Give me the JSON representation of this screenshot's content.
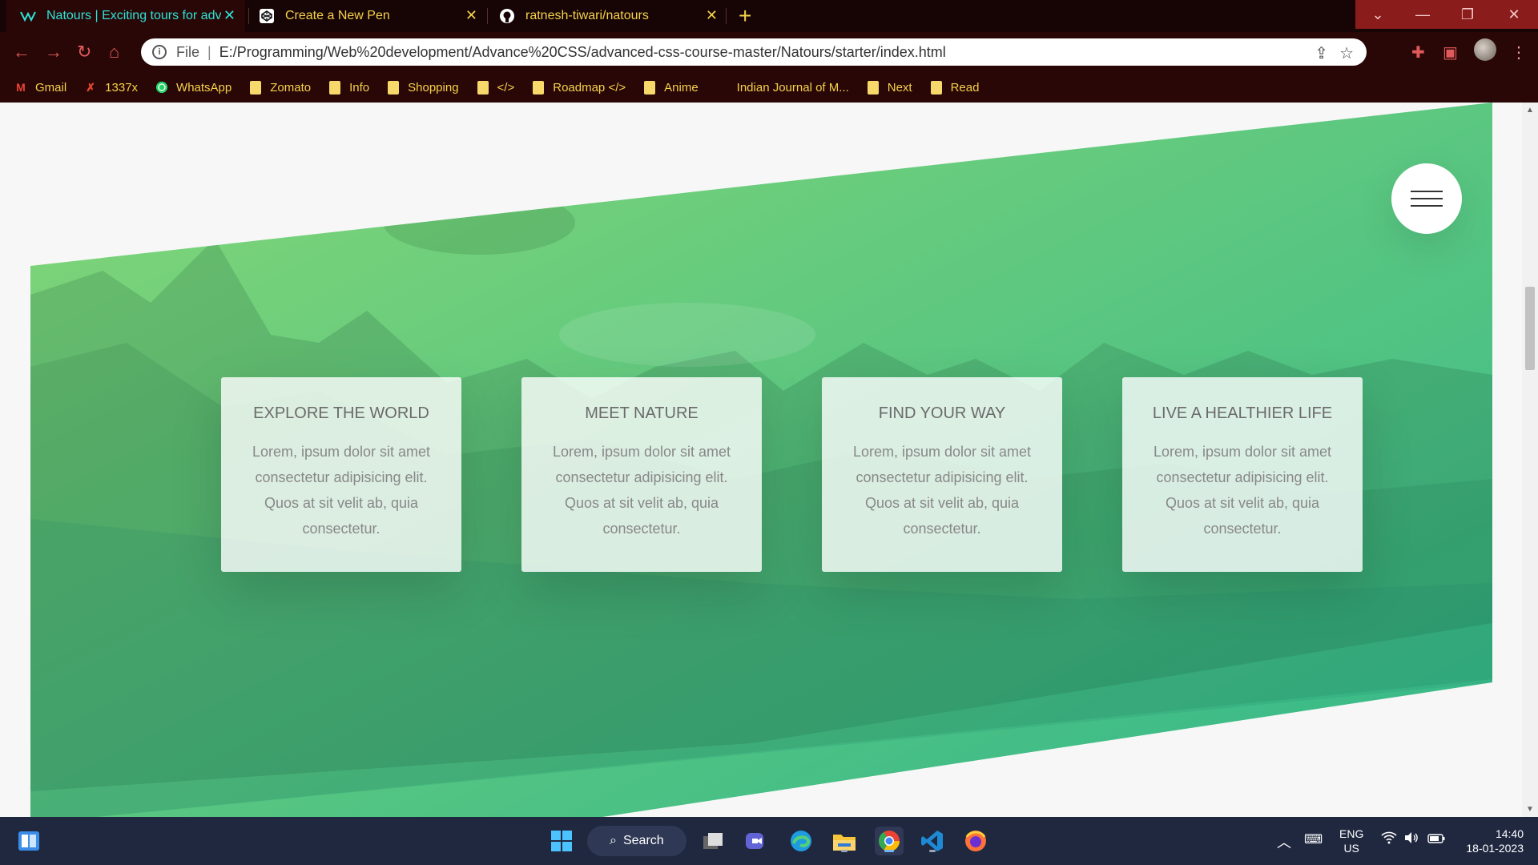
{
  "browser": {
    "tabs": [
      {
        "title": "Natours | Exciting tours for adventurous people",
        "icon": "natours-logo-icon",
        "active": true
      },
      {
        "title": "Create a New Pen",
        "icon": "codepen-icon",
        "active": false
      },
      {
        "title": "ratnesh-tiwari/natours",
        "icon": "github-icon",
        "active": false
      }
    ],
    "address": {
      "scheme_label": "File",
      "url": "E:/Programming/Web%20development/Advance%20CSS/advanced-css-course-master/Natours/starter/index.html"
    },
    "bookmarks": [
      {
        "label": "Gmail",
        "icon": "gmail-icon"
      },
      {
        "label": "1337x",
        "icon": "x-icon"
      },
      {
        "label": "WhatsApp",
        "icon": "whatsapp-icon"
      },
      {
        "label": "Zomato",
        "icon": "folder-icon"
      },
      {
        "label": "Info",
        "icon": "folder-icon"
      },
      {
        "label": "Shopping",
        "icon": "folder-icon"
      },
      {
        "label": "</>",
        "icon": "folder-icon"
      },
      {
        "label": "Roadmap </>",
        "icon": "folder-icon"
      },
      {
        "label": "Anime",
        "icon": "folder-icon"
      },
      {
        "label": "Indian Journal of M...",
        "icon": "none"
      },
      {
        "label": "Next",
        "icon": "folder-icon"
      },
      {
        "label": "Read",
        "icon": "folder-icon"
      }
    ]
  },
  "features": {
    "cards": [
      {
        "title": "EXPLORE THE WORLD",
        "text": "Lorem, ipsum dolor sit amet consectetur adipisicing elit. Quos at sit velit ab, quia consectetur."
      },
      {
        "title": "MEET NATURE",
        "text": "Lorem, ipsum dolor sit amet consectetur adipisicing elit. Quos at sit velit ab, quia consectetur."
      },
      {
        "title": "FIND YOUR WAY",
        "text": "Lorem, ipsum dolor sit amet consectetur adipisicing elit. Quos at sit velit ab, quia consectetur."
      },
      {
        "title": "LIVE A HEALTHIER LIFE",
        "text": "Lorem, ipsum dolor sit amet consectetur adipisicing elit. Quos at sit velit ab, quia consectetur."
      }
    ],
    "gradient": {
      "from": "#7ed56f",
      "to": "#28b485"
    }
  },
  "taskbar": {
    "search_label": "Search",
    "language": "ENG",
    "region": "US",
    "time": "14:40",
    "date": "18-01-2023"
  }
}
